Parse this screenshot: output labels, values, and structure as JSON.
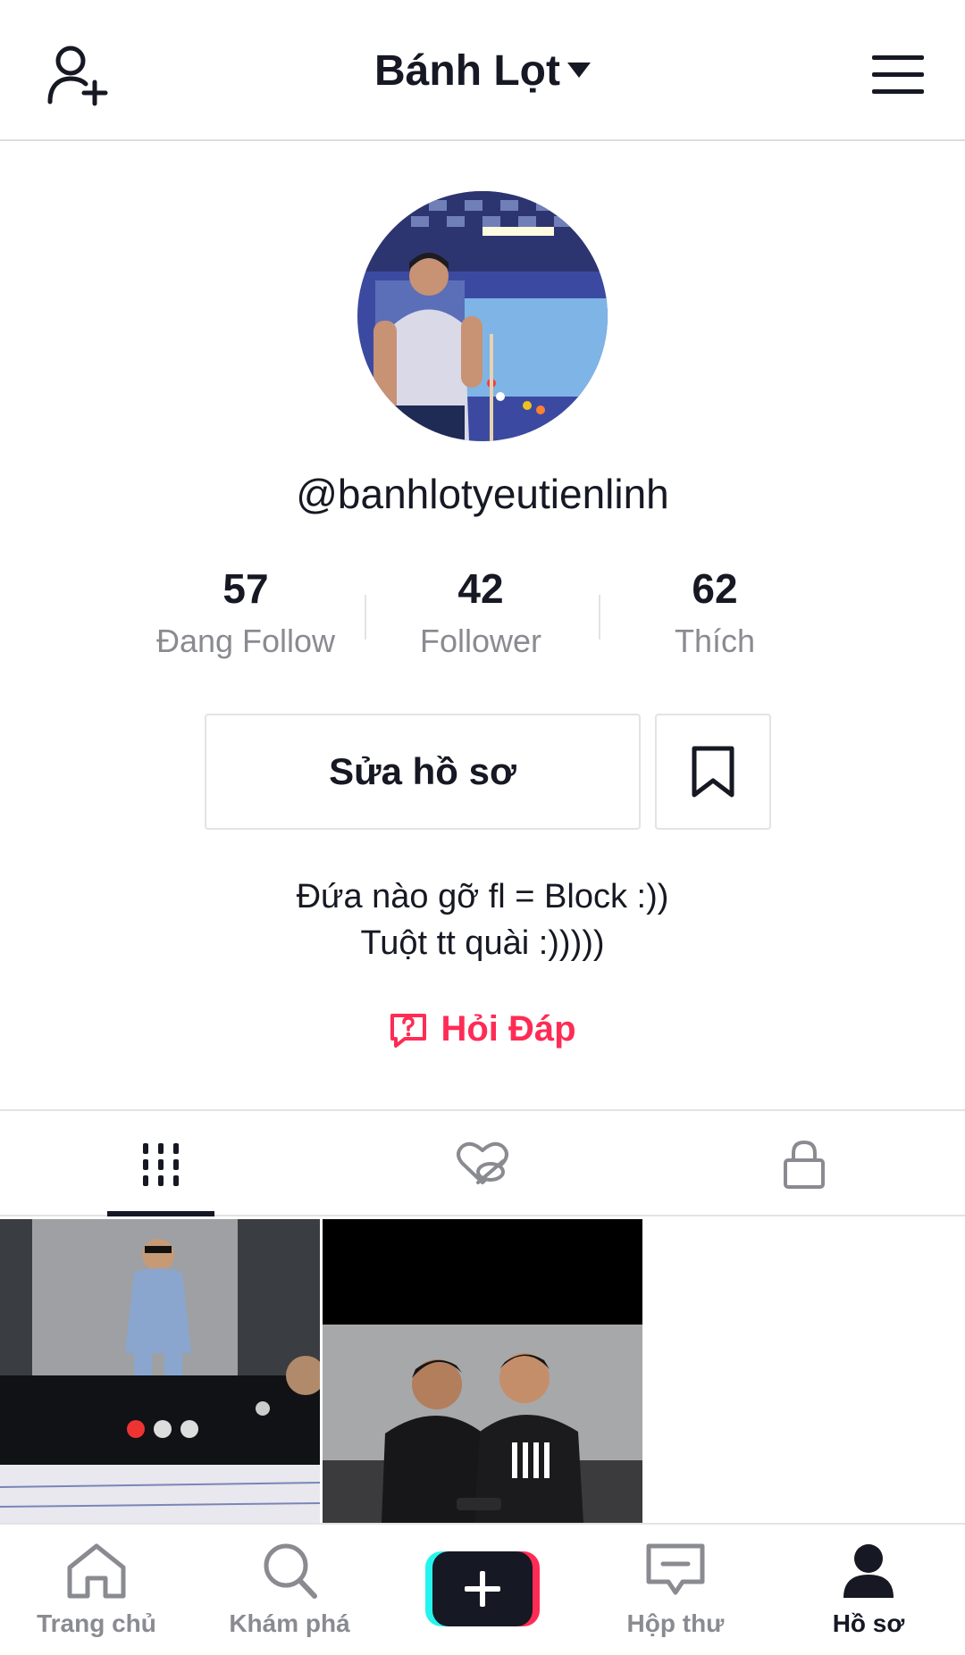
{
  "header": {
    "title": "Bánh Lọt",
    "add_user_icon": "add-user-icon",
    "menu_icon": "hamburger-menu-icon"
  },
  "profile": {
    "username": "@banhlotyeutienlinh",
    "stats": [
      {
        "value": "57",
        "label": "Đang Follow"
      },
      {
        "value": "42",
        "label": "Follower"
      },
      {
        "value": "62",
        "label": "Thích"
      }
    ],
    "edit_label": "Sửa hồ sơ",
    "bio_line1": "Đứa nào gỡ fl = Block :))",
    "bio_line2": "Tuột tt quài :)))))",
    "qa_label": "Hỏi Đáp"
  },
  "tabs": [
    {
      "icon": "videos-grid-icon",
      "active": true
    },
    {
      "icon": "liked-hidden-icon",
      "active": false
    },
    {
      "icon": "private-lock-icon",
      "active": false
    }
  ],
  "nav": [
    {
      "label": "Trang chủ",
      "icon": "home-icon"
    },
    {
      "label": "Khám phá",
      "icon": "search-icon"
    },
    {
      "label": "",
      "icon": "create-plus-icon"
    },
    {
      "label": "Hộp thư",
      "icon": "inbox-icon"
    },
    {
      "label": "Hồ sơ",
      "icon": "profile-icon",
      "active": true
    }
  ],
  "colors": {
    "accent": "#fe2c55",
    "text": "#161823",
    "muted": "#8a8b91",
    "border": "#e3e3e4"
  }
}
